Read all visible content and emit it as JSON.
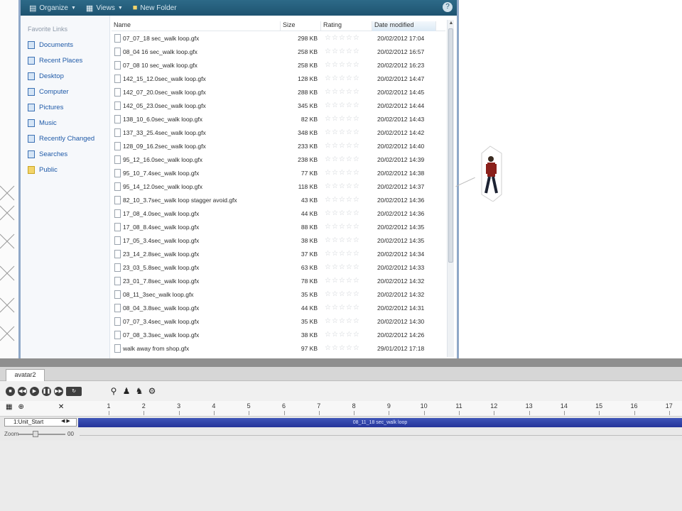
{
  "toolbar": {
    "organize_label": "Organize",
    "views_label": "Views",
    "new_folder_label": "New Folder"
  },
  "navpane": {
    "header": "Favorite Links",
    "items": [
      {
        "label": "Documents",
        "icon": "documents-icon"
      },
      {
        "label": "Recent Places",
        "icon": "recent-places-icon"
      },
      {
        "label": "Desktop",
        "icon": "desktop-icon"
      },
      {
        "label": "Computer",
        "icon": "computer-icon"
      },
      {
        "label": "Pictures",
        "icon": "pictures-icon"
      },
      {
        "label": "Music",
        "icon": "music-icon"
      },
      {
        "label": "Recently Changed",
        "icon": "recently-changed-icon"
      },
      {
        "label": "Searches",
        "icon": "searches-icon"
      },
      {
        "label": "Public",
        "icon": "public-folder-icon"
      }
    ]
  },
  "filelist": {
    "columns": {
      "name": "Name",
      "size": "Size",
      "rating": "Rating",
      "date": "Date modified"
    },
    "rows": [
      {
        "name": "07_07_18 sec_walk loop.gfx",
        "size": "298 KB",
        "date": "20/02/2012 17:04"
      },
      {
        "name": "08_04 16 sec_walk loop.gfx",
        "size": "258 KB",
        "date": "20/02/2012 16:57"
      },
      {
        "name": "07_08 10 sec_walk loop.gfx",
        "size": "258 KB",
        "date": "20/02/2012 16:23"
      },
      {
        "name": "142_15_12.0sec_walk loop.gfx",
        "size": "128 KB",
        "date": "20/02/2012 14:47"
      },
      {
        "name": "142_07_20.0sec_walk loop.gfx",
        "size": "288 KB",
        "date": "20/02/2012 14:45"
      },
      {
        "name": "142_05_23.0sec_walk loop.gfx",
        "size": "345 KB",
        "date": "20/02/2012 14:44"
      },
      {
        "name": "138_10_6.0sec_walk loop.gfx",
        "size": "82 KB",
        "date": "20/02/2012 14:43"
      },
      {
        "name": "137_33_25.4sec_walk loop.gfx",
        "size": "348 KB",
        "date": "20/02/2012 14:42"
      },
      {
        "name": "128_09_16.2sec_walk loop.gfx",
        "size": "233 KB",
        "date": "20/02/2012 14:40"
      },
      {
        "name": "95_12_16.0sec_walk loop.gfx",
        "size": "238 KB",
        "date": "20/02/2012 14:39"
      },
      {
        "name": "95_10_7.4sec_walk loop.gfx",
        "size": "77 KB",
        "date": "20/02/2012 14:38"
      },
      {
        "name": "95_14_12.0sec_walk loop.gfx",
        "size": "118 KB",
        "date": "20/02/2012 14:37"
      },
      {
        "name": "82_10_3.7sec_walk loop stagger avoid.gfx",
        "size": "43 KB",
        "date": "20/02/2012 14:36"
      },
      {
        "name": "17_08_4.0sec_walk loop.gfx",
        "size": "44 KB",
        "date": "20/02/2012 14:36"
      },
      {
        "name": "17_08_8.4sec_walk loop.gfx",
        "size": "88 KB",
        "date": "20/02/2012 14:35"
      },
      {
        "name": "17_05_3.4sec_walk loop.gfx",
        "size": "38 KB",
        "date": "20/02/2012 14:35"
      },
      {
        "name": "23_14_2.8sec_walk loop.gfx",
        "size": "37 KB",
        "date": "20/02/2012 14:34"
      },
      {
        "name": "23_03_5.8sec_walk loop.gfx",
        "size": "63 KB",
        "date": "20/02/2012 14:33"
      },
      {
        "name": "23_01_7.8sec_walk loop.gfx",
        "size": "78 KB",
        "date": "20/02/2012 14:32"
      },
      {
        "name": "08_11_3sec_walk loop.gfx",
        "size": "35 KB",
        "date": "20/02/2012 14:32"
      },
      {
        "name": "08_04_3.8sec_walk loop.gfx",
        "size": "44 KB",
        "date": "20/02/2012 14:31"
      },
      {
        "name": "07_07_3.4sec_walk loop.gfx",
        "size": "35 KB",
        "date": "20/02/2012 14:30"
      },
      {
        "name": "07_08_3.3sec_walk loop.gfx",
        "size": "38 KB",
        "date": "20/02/2012 14:26"
      },
      {
        "name": "walk away from shop.gfx",
        "size": "97 KB",
        "date": "29/01/2012 17:18"
      }
    ],
    "rating_glyph": "☆☆☆☆☆"
  },
  "bottom": {
    "tab_label": "avatar2",
    "ruler_ticks": [
      "1",
      "2",
      "3",
      "4",
      "5",
      "6",
      "7",
      "8",
      "9",
      "10",
      "11",
      "12",
      "13",
      "14",
      "15",
      "16",
      "17"
    ],
    "track_label": "1:Unit_Start",
    "clip_label": "08_11_18 sec_walk loop",
    "zoom_label": "Zoom",
    "zoom_value": "00",
    "zoom_fraction": 0.35
  }
}
